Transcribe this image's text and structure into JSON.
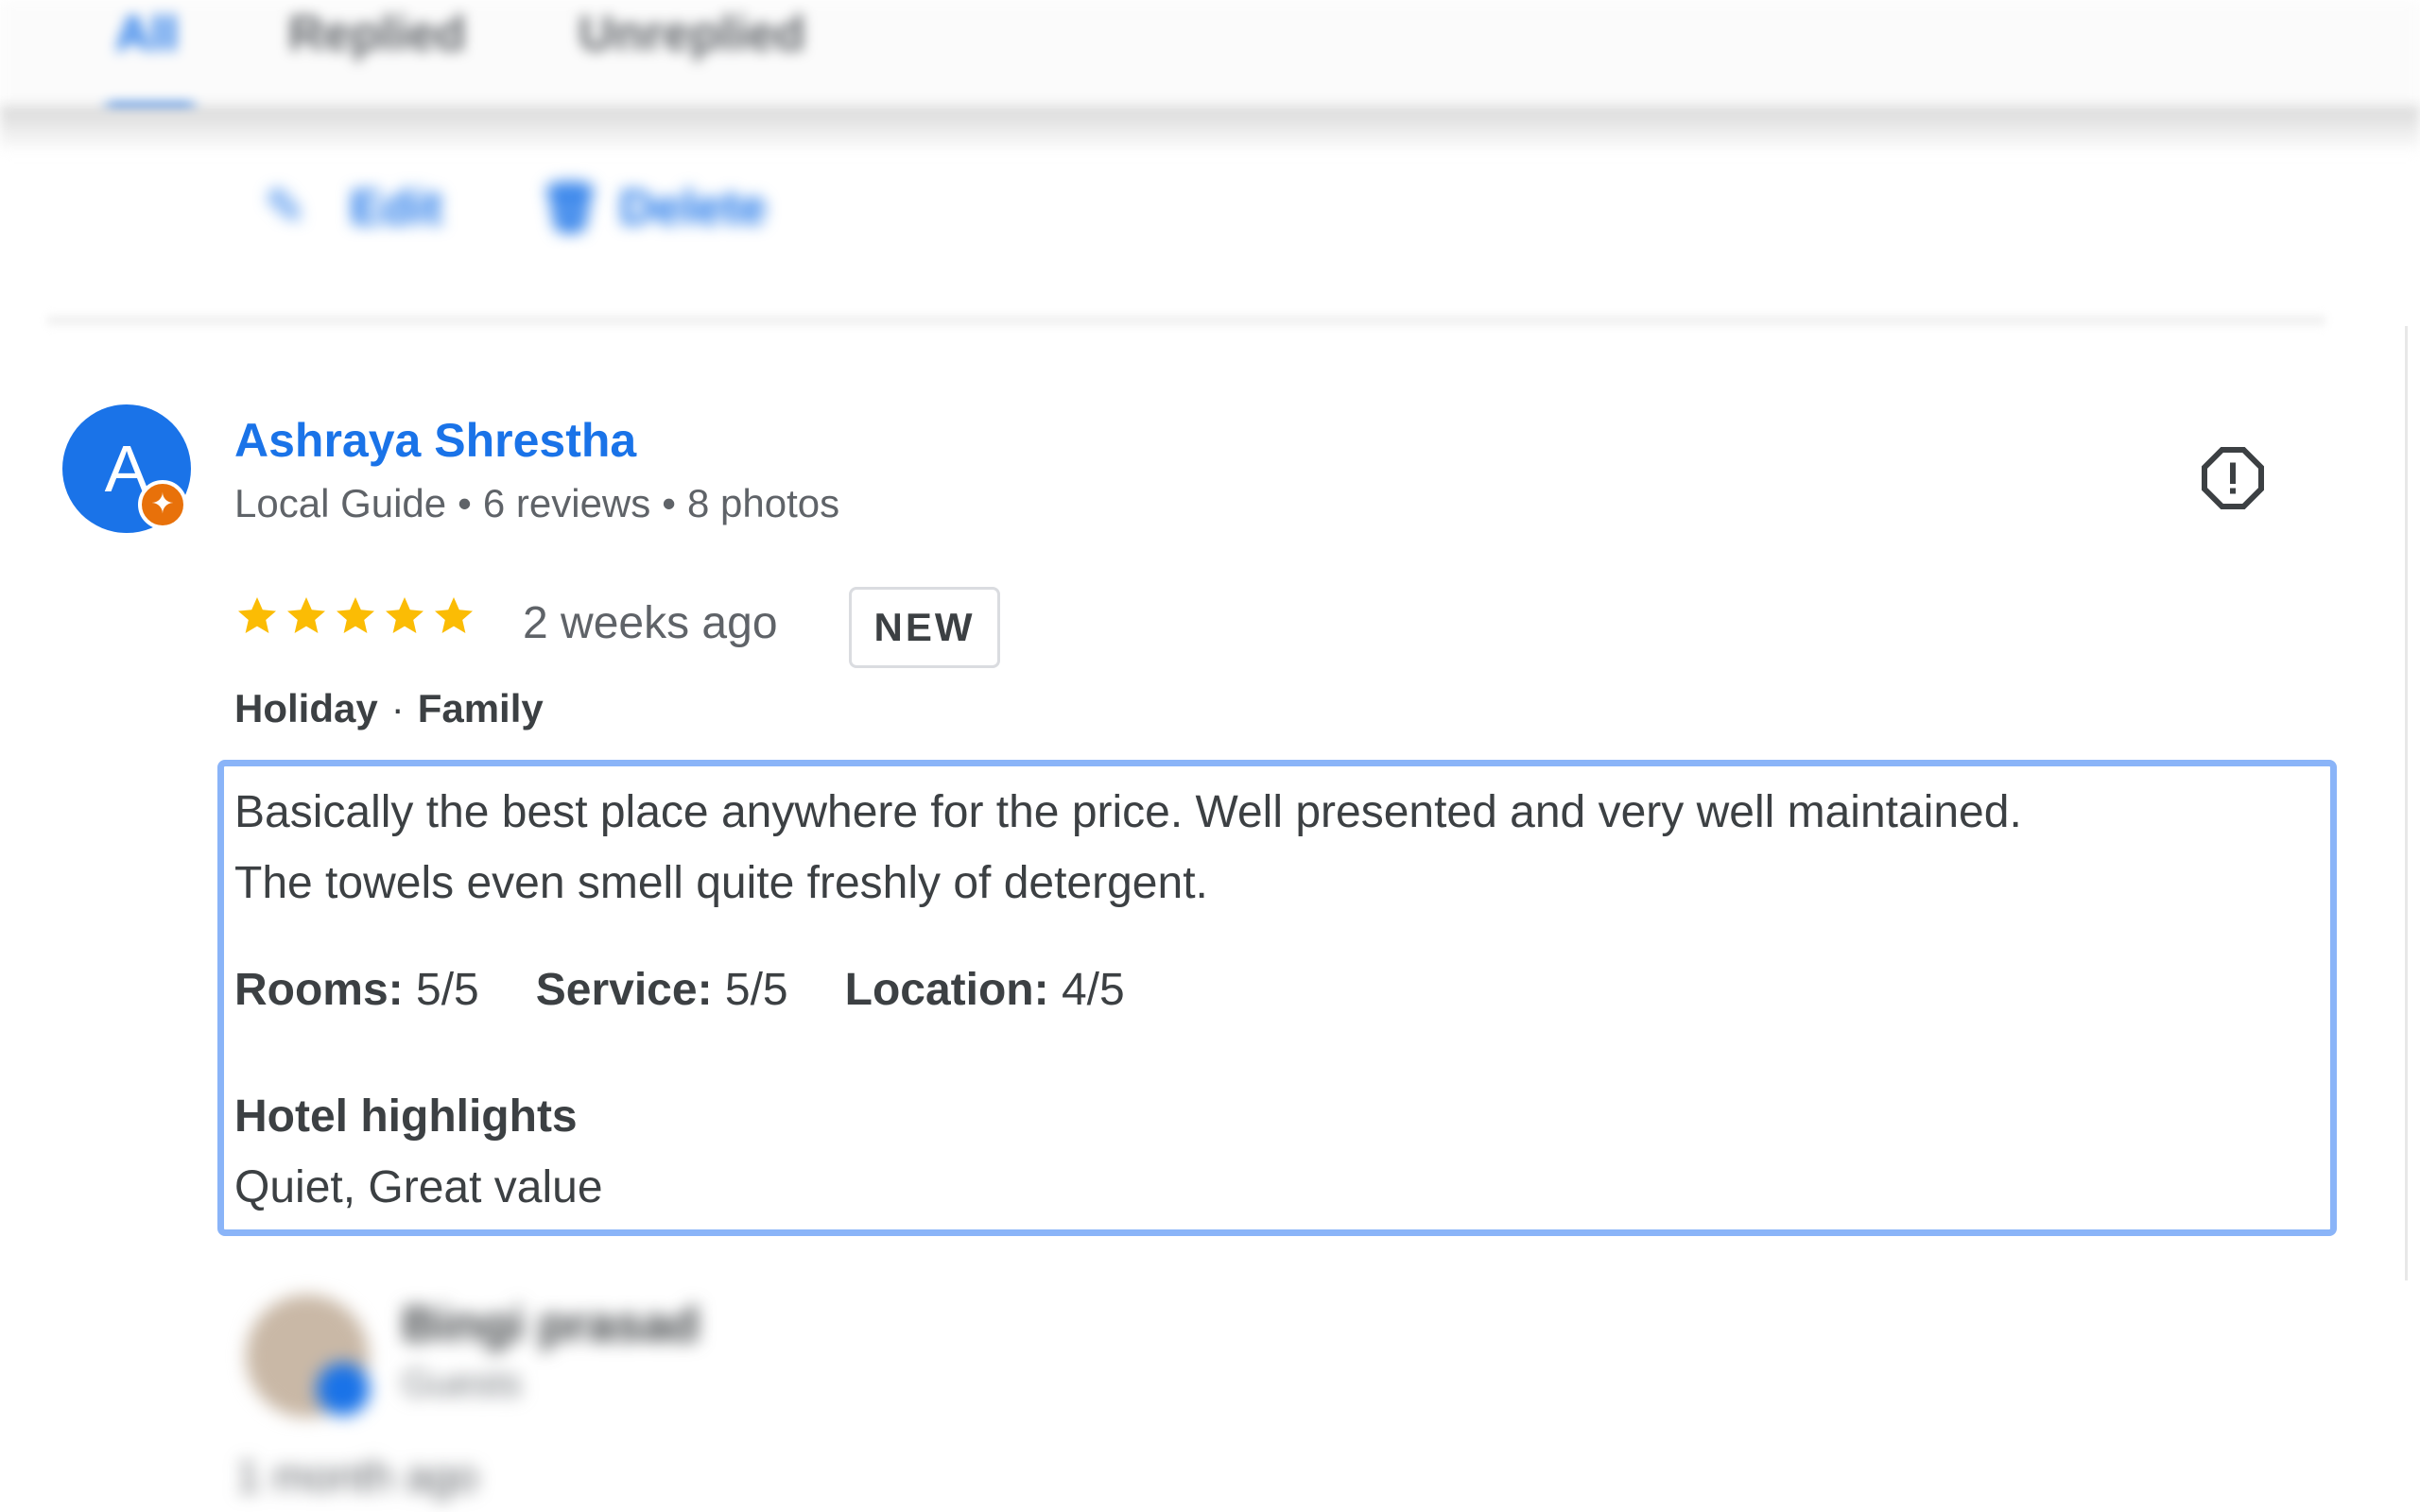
{
  "tabs": {
    "items": [
      {
        "label": "All"
      },
      {
        "label": "Replied"
      },
      {
        "label": "Unreplied"
      }
    ]
  },
  "reply_actions": {
    "edit_label": "Edit",
    "delete_label": "Delete"
  },
  "review": {
    "avatar_letter": "A",
    "reviewer_name": "Ashraya Shrestha",
    "meta": {
      "guide": "Local Guide",
      "reviews": "6 reviews",
      "photos": "8 photos"
    },
    "rating_stars": 5,
    "time_ago": "2 weeks ago",
    "new_badge": "NEW",
    "trip_type": "Holiday",
    "travel_group": "Family",
    "text_line1": "Basically the best place anywhere for the price. Well presented and very well maintained.",
    "text_line2": "The towels even smell quite freshly of detergent.",
    "ratings": [
      {
        "label": "Rooms:",
        "value": "5/5"
      },
      {
        "label": "Service:",
        "value": "5/5"
      },
      {
        "label": "Location:",
        "value": "4/5"
      }
    ],
    "highlights_title": "Hotel highlights",
    "highlights_value": "Quiet, Great value"
  },
  "next_review": {
    "name": "Bingi prasad",
    "meta": "Guests",
    "time_ago": "1 month ago"
  },
  "colors": {
    "link_blue": "#1a73e8",
    "star_gold": "#fbbc04",
    "guide_orange": "#e8710a",
    "highlight_border": "#8ab4f8"
  },
  "icons": {
    "report": "report-flag-icon",
    "star": "star-icon",
    "guide_badge": "local-guide-badge-icon",
    "edit": "pencil-icon",
    "delete": "trash-icon"
  }
}
